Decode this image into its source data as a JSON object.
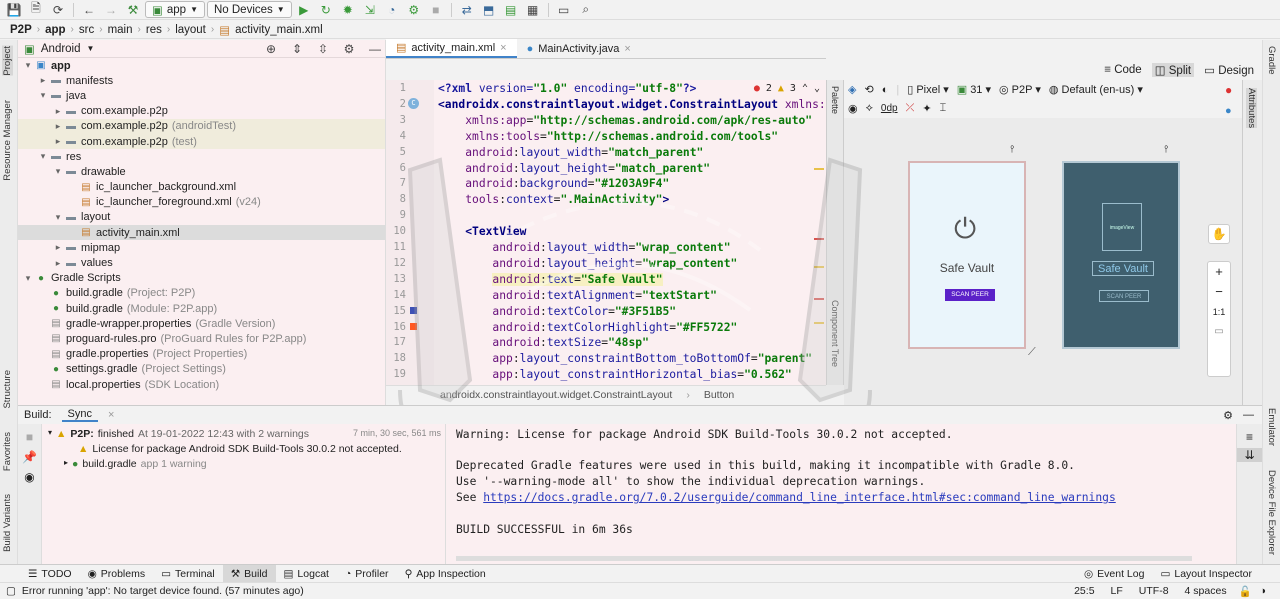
{
  "toolbar": {
    "config": "app",
    "device": "No Devices",
    "icons": [
      "save-icon",
      "save-all-icon",
      "sync-icon",
      "back-icon",
      "forward-icon",
      "hammer-icon",
      "run-icon",
      "rerun-icon",
      "debug-icon",
      "attach-debugger-icon",
      "profile-icon",
      "apply-changes-icon",
      "stop-icon",
      "avd-icon",
      "sdk-icon",
      "project-structure-icon",
      "device-manager-icon",
      "layout-inspector-icon",
      "search-icon"
    ]
  },
  "breadcrumb": [
    "P2P",
    "app",
    "src",
    "main",
    "res",
    "layout",
    "activity_main.xml"
  ],
  "project": {
    "view": "Android",
    "tree": [
      {
        "indent": 0,
        "arrow": "▾",
        "icon": "module",
        "label": "app",
        "bold": true,
        "hint": ""
      },
      {
        "indent": 1,
        "arrow": "▸",
        "icon": "folder",
        "label": "manifests",
        "hint": ""
      },
      {
        "indent": 1,
        "arrow": "▾",
        "icon": "folder",
        "label": "java",
        "hint": ""
      },
      {
        "indent": 2,
        "arrow": "▸",
        "icon": "package",
        "label": "com.example.p2p",
        "hint": ""
      },
      {
        "indent": 2,
        "arrow": "▸",
        "icon": "package",
        "label": "com.example.p2p",
        "hint": "(androidTest)",
        "tint": true
      },
      {
        "indent": 2,
        "arrow": "▸",
        "icon": "package",
        "label": "com.example.p2p",
        "hint": "(test)",
        "tint": true
      },
      {
        "indent": 1,
        "arrow": "▾",
        "icon": "folder",
        "label": "res",
        "hint": ""
      },
      {
        "indent": 2,
        "arrow": "▾",
        "icon": "folder",
        "label": "drawable",
        "hint": ""
      },
      {
        "indent": 3,
        "arrow": "",
        "icon": "xml",
        "label": "ic_launcher_background.xml",
        "hint": ""
      },
      {
        "indent": 3,
        "arrow": "",
        "icon": "xml",
        "label": "ic_launcher_foreground.xml",
        "hint": "(v24)"
      },
      {
        "indent": 2,
        "arrow": "▾",
        "icon": "folder",
        "label": "layout",
        "hint": ""
      },
      {
        "indent": 3,
        "arrow": "",
        "icon": "xml",
        "label": "activity_main.xml",
        "hint": "",
        "selected": true
      },
      {
        "indent": 2,
        "arrow": "▸",
        "icon": "folder",
        "label": "mipmap",
        "hint": ""
      },
      {
        "indent": 2,
        "arrow": "▸",
        "icon": "folder",
        "label": "values",
        "hint": ""
      },
      {
        "indent": 0,
        "arrow": "▾",
        "icon": "gradle",
        "label": "Gradle Scripts",
        "hint": ""
      },
      {
        "indent": 1,
        "arrow": "",
        "icon": "gradle",
        "label": "build.gradle",
        "hint": "(Project: P2P)"
      },
      {
        "indent": 1,
        "arrow": "",
        "icon": "gradle",
        "label": "build.gradle",
        "hint": "(Module: P2P.app)"
      },
      {
        "indent": 1,
        "arrow": "",
        "icon": "props",
        "label": "gradle-wrapper.properties",
        "hint": "(Gradle Version)"
      },
      {
        "indent": 1,
        "arrow": "",
        "icon": "props",
        "label": "proguard-rules.pro",
        "hint": "(ProGuard Rules for P2P.app)"
      },
      {
        "indent": 1,
        "arrow": "",
        "icon": "props",
        "label": "gradle.properties",
        "hint": "(Project Properties)"
      },
      {
        "indent": 1,
        "arrow": "",
        "icon": "gradle",
        "label": "settings.gradle",
        "hint": "(Project Settings)"
      },
      {
        "indent": 1,
        "arrow": "",
        "icon": "props",
        "label": "local.properties",
        "hint": "(SDK Location)"
      }
    ]
  },
  "editor": {
    "tabs": [
      {
        "label": "activity_main.xml",
        "active": true
      },
      {
        "label": "MainActivity.java",
        "active": false
      }
    ],
    "inspections": {
      "errors": "2",
      "warnings": "3"
    },
    "line_numbers": [
      "1",
      "2",
      "3",
      "4",
      "5",
      "6",
      "7",
      "8",
      "9",
      "10",
      "11",
      "12",
      "13",
      "14",
      "15",
      "16",
      "17",
      "18",
      "19"
    ],
    "breadcrumb": [
      "androidx.constraintlayout.widget.ConstraintLayout",
      "Button"
    ]
  },
  "design": {
    "modes": [
      "Code",
      "Split",
      "Design"
    ],
    "device": "Pixel",
    "api": "31",
    "theme": "P2P",
    "locale": "Default (en-us)",
    "margin": "0dp",
    "phone_title": "Safe Vault",
    "phone_button": "SCAN PEER",
    "blueprint_image": "imageView",
    "zoom_fit": "1:1"
  },
  "side_tabs": {
    "left": [
      "Project",
      "Resource Manager",
      "Structure",
      "Favorites",
      "Build Variants"
    ],
    "right": [
      "Gradle",
      "Attributes",
      "Emulator",
      "Device File Explorer"
    ],
    "palette": "Palette",
    "component_tree": "Component Tree"
  },
  "build": {
    "title": "Build:",
    "tab": "Sync",
    "items": [
      {
        "label": "P2P:",
        "status": "finished",
        "detail": "At 19-01-2022 12:43 with 2 warnings",
        "time": "7 min, 30 sec, 561 ms"
      },
      {
        "label": "License for package Android SDK Build-Tools 30.0.2 not accepted.",
        "status": "",
        "detail": "",
        "time": ""
      },
      {
        "label": "build.gradle",
        "status": "",
        "detail": "app 1 warning",
        "time": ""
      }
    ],
    "output": [
      "Warning: License for package Android SDK Build-Tools 30.0.2 not accepted.",
      "",
      "Deprecated Gradle features were used in this build, making it incompatible with Gradle 8.0.",
      "Use '--warning-mode all' to show the individual deprecation warnings.",
      "See ",
      "",
      "BUILD SUCCESSFUL in 6m 36s"
    ],
    "output_link": "https://docs.gradle.org/7.0.2/userguide/command_line_interface.html#sec:command_line_warnings"
  },
  "bottom_tools": [
    "TODO",
    "Problems",
    "Terminal",
    "Build",
    "Logcat",
    "Profiler",
    "App Inspection"
  ],
  "bottom_right_tools": [
    "Event Log",
    "Layout Inspector"
  ],
  "status": {
    "message": "Error running 'app': No target device found. (57 minutes ago)",
    "position": "25:5",
    "line_sep": "LF",
    "encoding": "UTF-8",
    "indent": "4 spaces"
  },
  "colors": {
    "accent": "#4083c9",
    "bg_pink": "#fbeff1",
    "blueprint": "#3f5f6e",
    "button_purple": "#5b21c8"
  }
}
